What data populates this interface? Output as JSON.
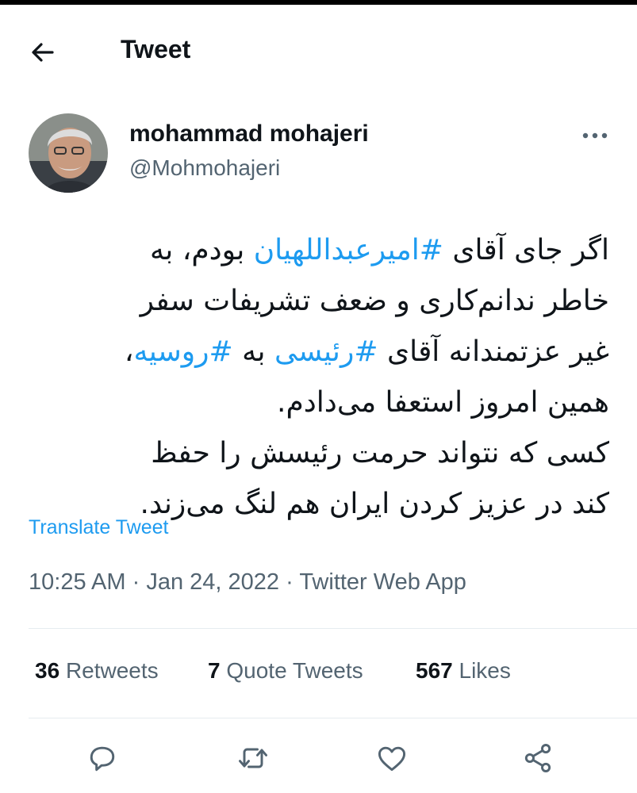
{
  "header": {
    "title": "Tweet"
  },
  "tweet": {
    "author": {
      "display_name": "mohammad mohajeri",
      "handle": "@Mohmohajeri"
    },
    "text_lines": [
      [
        {
          "t": "اگر جای آقای "
        },
        {
          "t": "#امیرعبداللهیان",
          "tag": true
        },
        {
          "t": " بودم، به"
        }
      ],
      [
        {
          "t": "خاطر ندانم‌کاری و ضعف تشریفات سفر"
        }
      ],
      [
        {
          "t": "غیر عزتمندانه آقای "
        },
        {
          "t": "#رئیسی",
          "tag": true
        },
        {
          "t": " به "
        },
        {
          "t": "#روسیه",
          "tag": true
        },
        {
          "t": "،"
        }
      ],
      [
        {
          "t": "همین امروز استعفا می‌دادم."
        }
      ],
      [
        {
          "t": "کسی که نتواند حرمت رئیسش را حفظ"
        }
      ],
      [
        {
          "t": "کند در عزیز کردن ایران هم لنگ می‌زند."
        }
      ]
    ],
    "translate_label": "Translate Tweet",
    "time": "10:25 AM",
    "date": "Jan 24, 2022",
    "source": "Twitter Web App",
    "separator": "·"
  },
  "stats": {
    "retweets": {
      "count": "36",
      "label": "Retweets"
    },
    "quotes": {
      "count": "7",
      "label": "Quote Tweets"
    },
    "likes": {
      "count": "567",
      "label": "Likes"
    }
  },
  "actions": [
    {
      "icon": "reply-icon"
    },
    {
      "icon": "retweet-icon"
    },
    {
      "icon": "like-icon"
    },
    {
      "icon": "share-icon"
    }
  ],
  "colors": {
    "link": "#1d9bf0",
    "secondary": "#536471",
    "primary": "#0f1419",
    "icon": "#536471"
  }
}
